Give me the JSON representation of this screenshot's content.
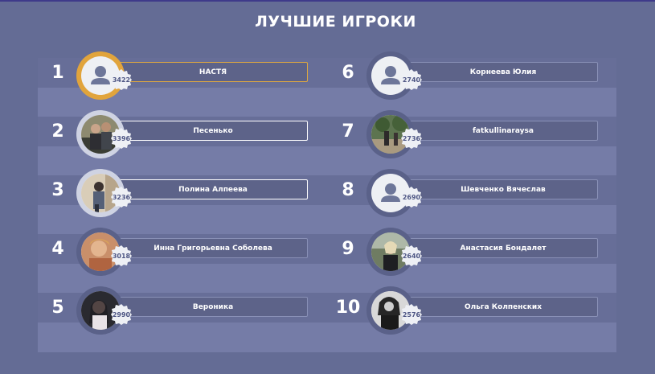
{
  "title": "ЛУЧШИЕ ИГРОКИ",
  "colors": {
    "background": "#646c95",
    "board": "#757ca7",
    "band": "#676e98",
    "gold": "#e1a43c",
    "silver": "#cfd3e3",
    "name_bar": "#5d6389"
  },
  "players": [
    {
      "rank": "1",
      "name": "НАСТЯ",
      "score": "3422",
      "avatar": "default-user-icon",
      "medal": "gold"
    },
    {
      "rank": "2",
      "name": "Песенько",
      "score": "3396",
      "avatar": "photo",
      "medal": "silver"
    },
    {
      "rank": "3",
      "name": "Полина Алпеева",
      "score": "3236",
      "avatar": "photo",
      "medal": "silver"
    },
    {
      "rank": "4",
      "name": "Инна Григорьевна Соболева",
      "score": "3018",
      "avatar": "photo",
      "medal": "none"
    },
    {
      "rank": "5",
      "name": "Вероника",
      "score": "2990",
      "avatar": "photo",
      "medal": "none"
    },
    {
      "rank": "6",
      "name": "Корнеева Юлия",
      "score": "2740",
      "avatar": "default-user-icon",
      "medal": "none"
    },
    {
      "rank": "7",
      "name": "fatkullinaraysa",
      "score": "2736",
      "avatar": "photo",
      "medal": "none"
    },
    {
      "rank": "8",
      "name": "Шевченко Вячеслав",
      "score": "2690",
      "avatar": "default-user-icon",
      "medal": "none"
    },
    {
      "rank": "9",
      "name": "Анастасия Бондалет",
      "score": "2640",
      "avatar": "photo",
      "medal": "none"
    },
    {
      "rank": "10",
      "name": "Ольга Колпенских",
      "score": "2576",
      "avatar": "photo",
      "medal": "none"
    }
  ]
}
